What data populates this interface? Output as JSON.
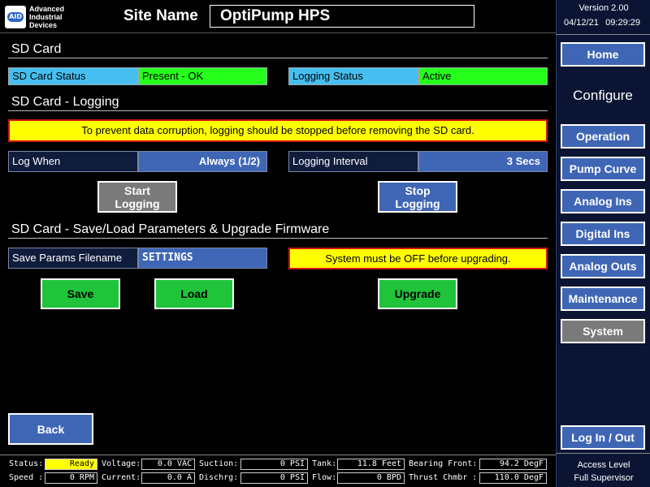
{
  "header": {
    "logo_mark": "AID",
    "logo_line1": "Advanced",
    "logo_line2": "Industrial",
    "logo_line3": "Devices",
    "site_label": "Site Name",
    "site_name": "OptiPump HPS",
    "version": "Version 2.00",
    "date": "04/12/21",
    "time": "09:29:29"
  },
  "sections": {
    "sd_card": "SD Card",
    "logging": "SD Card - Logging",
    "save_load": "SD Card - Save/Load Parameters & Upgrade Firmware"
  },
  "sd_status": {
    "card_label": "SD Card Status",
    "card_value": "Present - OK",
    "log_label": "Logging Status",
    "log_value": "Active"
  },
  "logging": {
    "warning": "To prevent data corruption, logging should be stopped before removing the SD card.",
    "log_when_label": "Log When",
    "log_when_value": "Always (1/2)",
    "interval_label": "Logging Interval",
    "interval_value": "3 Secs",
    "start_line1": "Start",
    "start_line2": "Logging",
    "stop_line1": "Stop",
    "stop_line2": "Logging"
  },
  "params": {
    "filename_label": "Save Params Filename",
    "filename_value": "SETTINGS",
    "upgrade_warning": "System must be OFF before upgrading.",
    "save": "Save",
    "load": "Load",
    "upgrade": "Upgrade",
    "back": "Back"
  },
  "sidebar": {
    "home": "Home",
    "configure": "Configure",
    "items": [
      "Operation",
      "Pump Curve",
      "Analog Ins",
      "Digital Ins",
      "Analog Outs",
      "Maintenance",
      "System"
    ],
    "login": "Log In / Out",
    "access_label": "Access Level",
    "access_value": "Full Supervisor"
  },
  "status_bar": {
    "status_label": "Status:",
    "status_value": "Ready",
    "speed_label": "Speed :",
    "speed_value": "0 RPM",
    "voltage_label": "Voltage:",
    "voltage_value": "0.0 VAC",
    "current_label": "Current:",
    "current_value": "0.0 A",
    "suction_label": "Suction:",
    "suction_value": "0 PSI",
    "dischrg_label": "Dischrg:",
    "dischrg_value": "0 PSI",
    "tank_label": "Tank:",
    "tank_value": "11.8 Feet",
    "flow_label": "Flow:",
    "flow_value": "0 BPD",
    "bearing_label": "Bearing Front:",
    "bearing_value": "94.2 DegF",
    "thrust_label": "Thrust Chmbr :",
    "thrust_value": "110.0 DegF"
  },
  "colors": {
    "label_blue": "#46bff0",
    "ok_green": "#26ff1c",
    "button_steel": "#3f66b5",
    "button_green": "#1fc43a",
    "warning_yellow": "#ffff00",
    "warning_border": "#d01515"
  }
}
